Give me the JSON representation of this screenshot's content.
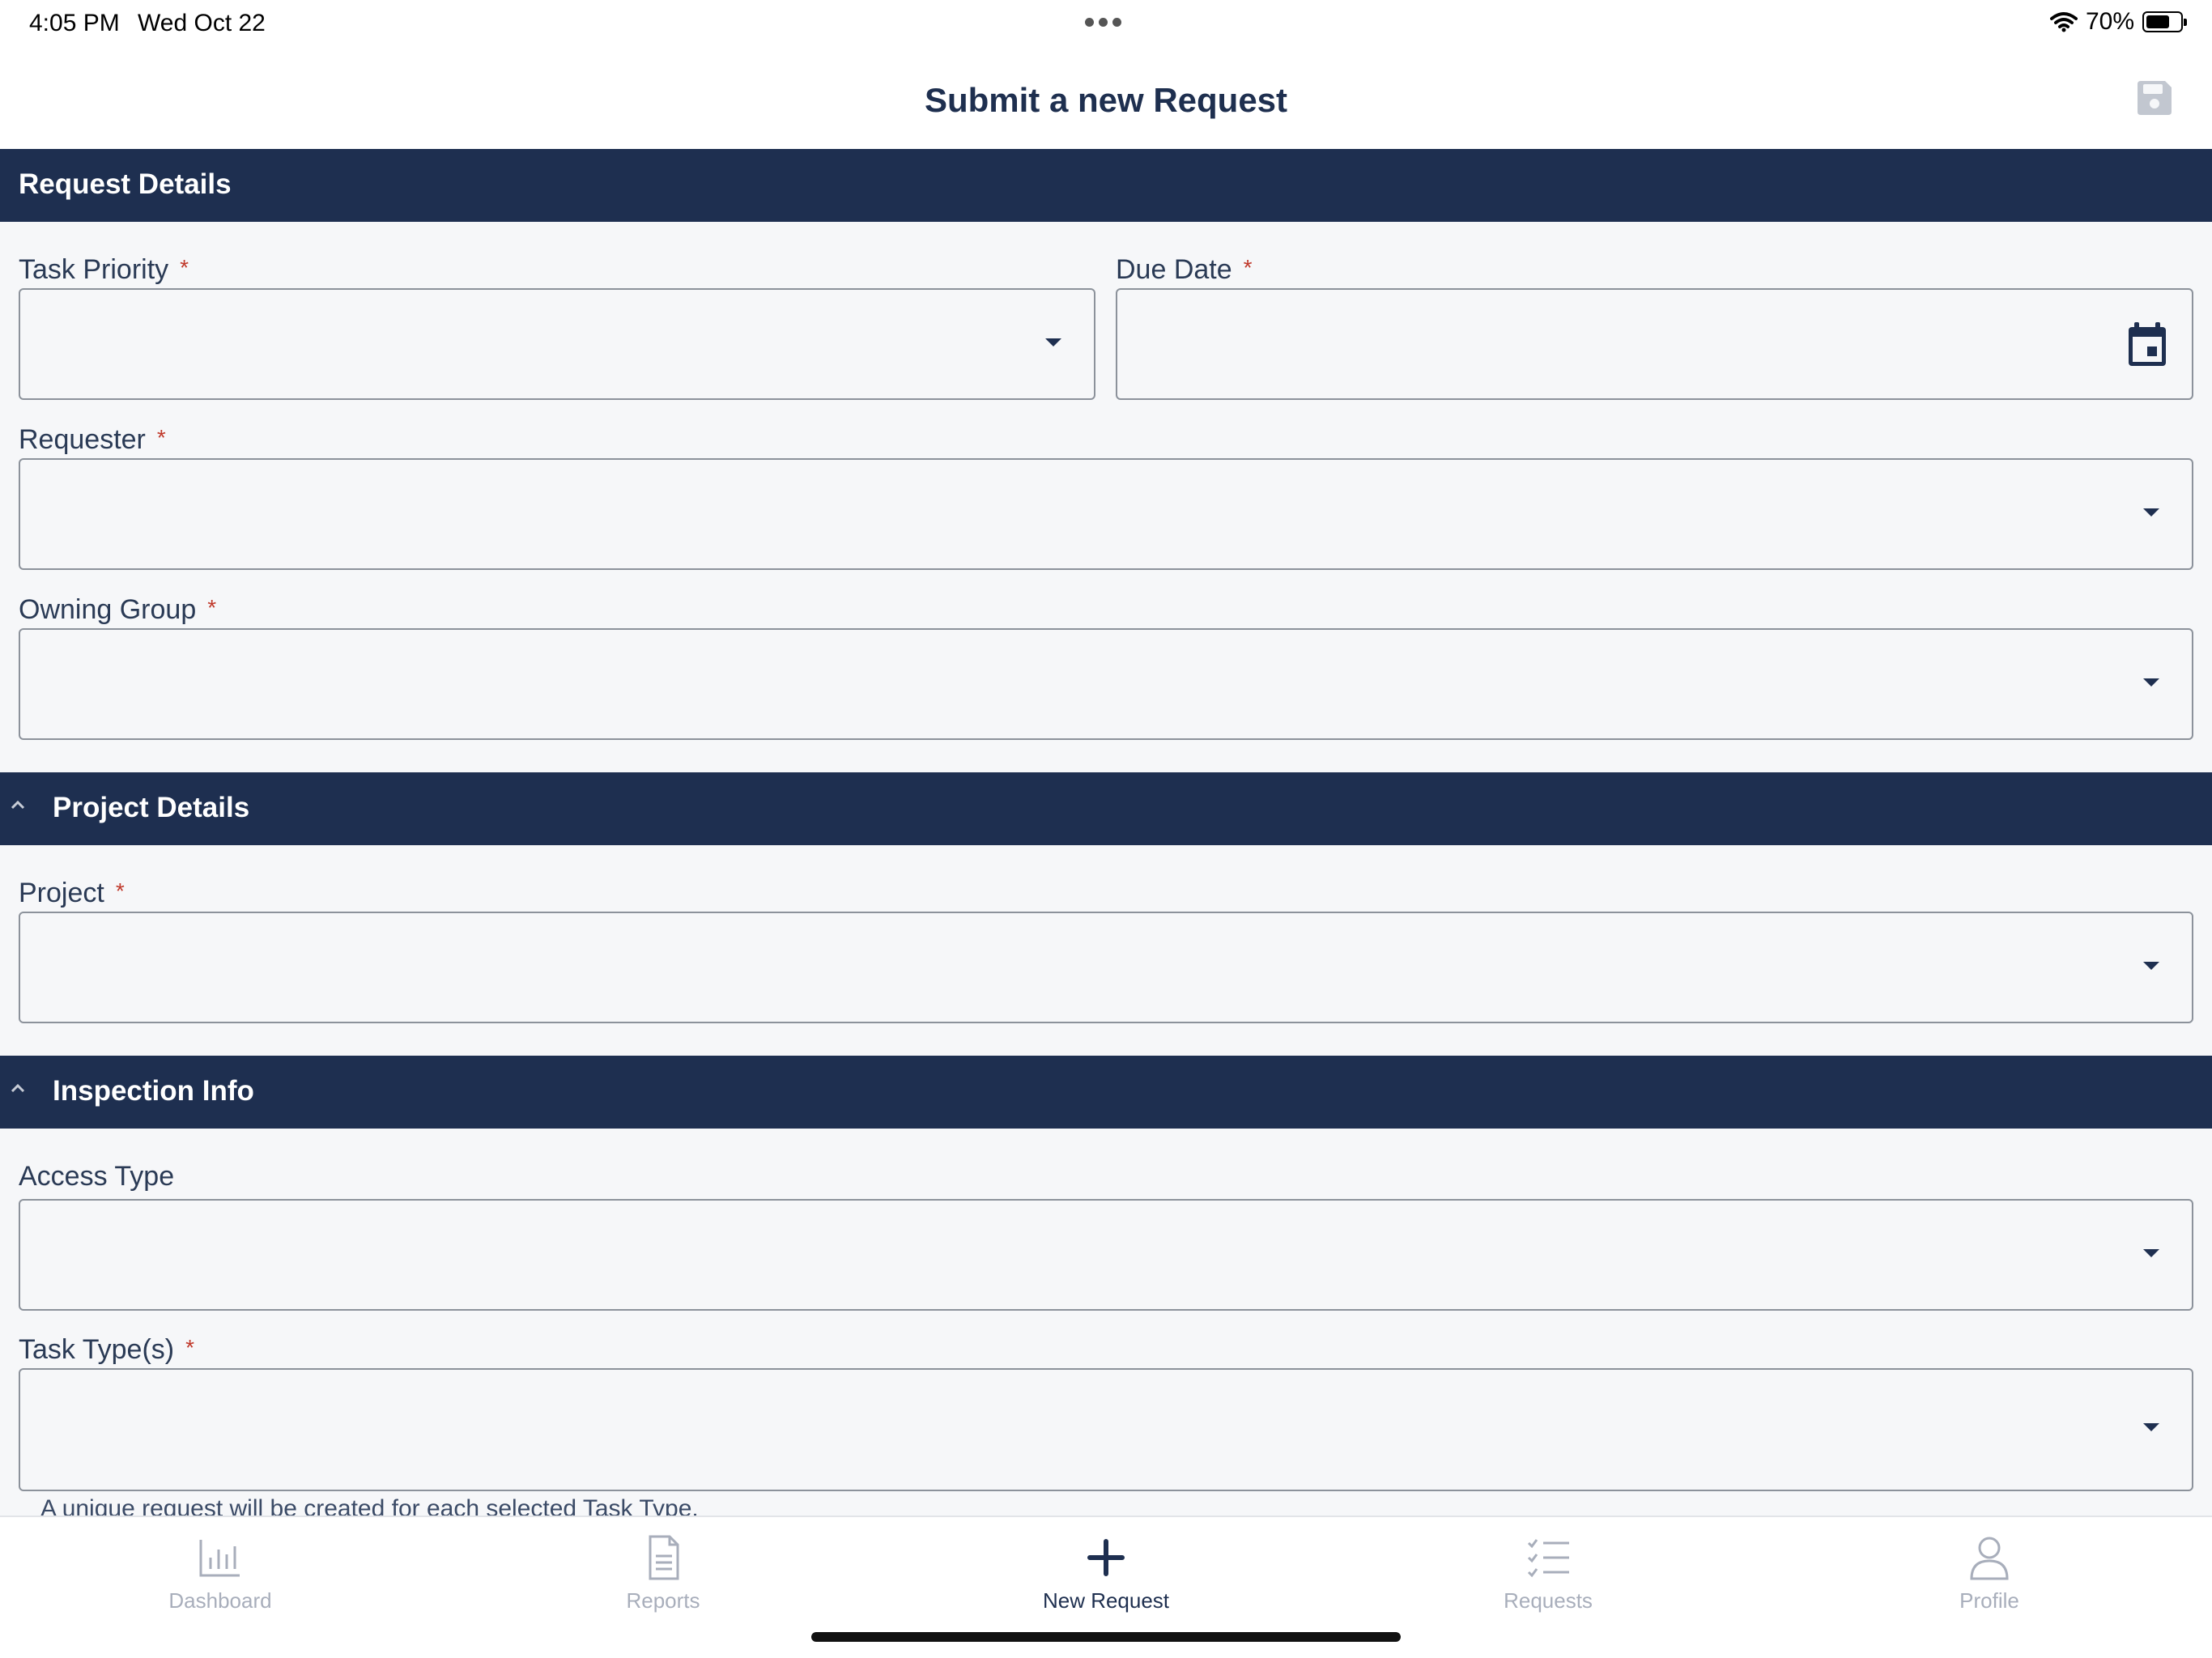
{
  "status": {
    "time": "4:05 PM",
    "date": "Wed Oct 22",
    "battery": "70%",
    "battery_level": 0.7
  },
  "header": {
    "title": "Submit a new Request",
    "save_icon": "save-icon"
  },
  "sections": {
    "request_details": {
      "title": "Request Details",
      "fields": {
        "task_priority": {
          "label": "Task Priority",
          "required": "*",
          "value": ""
        },
        "due_date": {
          "label": "Due Date",
          "required": "*",
          "value": ""
        },
        "requester": {
          "label": "Requester",
          "required": "*",
          "value": ""
        },
        "owning_group": {
          "label": "Owning Group",
          "required": "*",
          "value": ""
        }
      }
    },
    "project_details": {
      "title": "Project Details",
      "fields": {
        "project": {
          "label": "Project",
          "required": "*",
          "value": ""
        }
      }
    },
    "inspection_info": {
      "title": "Inspection Info",
      "fields": {
        "access_type": {
          "label": "Access Type",
          "value": ""
        },
        "task_types": {
          "label": "Task Type(s)",
          "required": "*",
          "value": ""
        }
      },
      "helper_text": "A unique request will be created for each selected Task Type."
    }
  },
  "tabs": [
    {
      "label": "Dashboard",
      "icon": "bar-chart-icon",
      "active": false
    },
    {
      "label": "Reports",
      "icon": "document-icon",
      "active": false
    },
    {
      "label": "New Request",
      "icon": "plus-icon",
      "active": true
    },
    {
      "label": "Requests",
      "icon": "checklist-icon",
      "active": false
    },
    {
      "label": "Profile",
      "icon": "person-icon",
      "active": false
    }
  ],
  "colors": {
    "navy": "#1e2f50",
    "required": "#c0392b",
    "inactive_tab": "#a8aebb"
  }
}
